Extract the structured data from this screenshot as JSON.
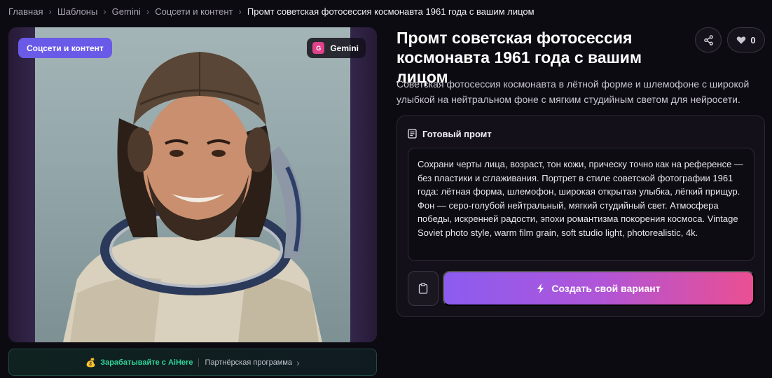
{
  "breadcrumb": {
    "items": [
      "Главная",
      "Шаблоны",
      "Gemini",
      "Соцсети и контент"
    ],
    "current": "Промт советская фотосессия космонавта 1961 года с вашим лицом",
    "separator": "›"
  },
  "image_card": {
    "category_tag": "Соцсети и контент",
    "model_label": "Gemini",
    "model_icon_letter": "G"
  },
  "earn_bar": {
    "earn_text": "Зарабатывайте с AiHere",
    "partner_text": "Партнёрская программа",
    "chevron": "›"
  },
  "header": {
    "title": "Промт советская фотосессия космонавта 1961 года с вашим лицом",
    "likes_count": "0"
  },
  "description": "Советская фотосессия космонавта в лётной форме и шлемофоне с широкой улыбкой на нейтральном фоне с мягким студийным светом для нейросети.",
  "prompt": {
    "heading": "Готовый промт",
    "text": "Сохрани черты лица, возраст, тон кожи, прическу точно как на референсе — без пластики и сглаживания. Портрет в стиле советской фотографии 1961 года: лётная форма, шлемофон, широкая открытая улыбка, лёгкий прищур. Фон — серо-голубой нейтральный, мягкий студийный свет. Атмосфера победы, искренней радости, эпохи романтизма покорения космоса. Vintage Soviet photo style, warm film grain, soft studio light, photorealistic, 4k.",
    "create_label": "Создать свой вариант"
  },
  "colors": {
    "accent_purple": "#6a5ae8",
    "gradient_start": "#8b5cf0",
    "gradient_end": "#ea4f92",
    "earn_green": "#30d69a"
  }
}
